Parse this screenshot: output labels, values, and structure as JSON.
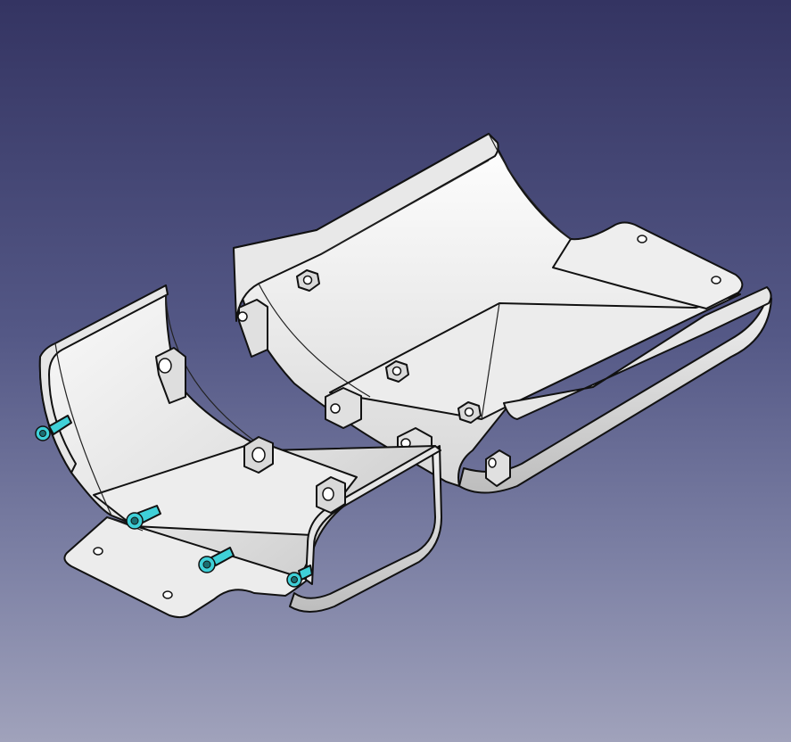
{
  "view": {
    "background_top": "#343462",
    "background_bottom": "#a0a2bb"
  },
  "model": {
    "parts": [
      "rear-shell",
      "front-shell"
    ],
    "hardware": {
      "nuts_visible": 6,
      "screws_visible": 4
    },
    "colors": {
      "shell_fill": "#e4e4e4",
      "shell_shade": "#c9c9c9",
      "edge": "#111111",
      "screw": "#3fd0d8",
      "nut": "#d9d9d9"
    }
  }
}
